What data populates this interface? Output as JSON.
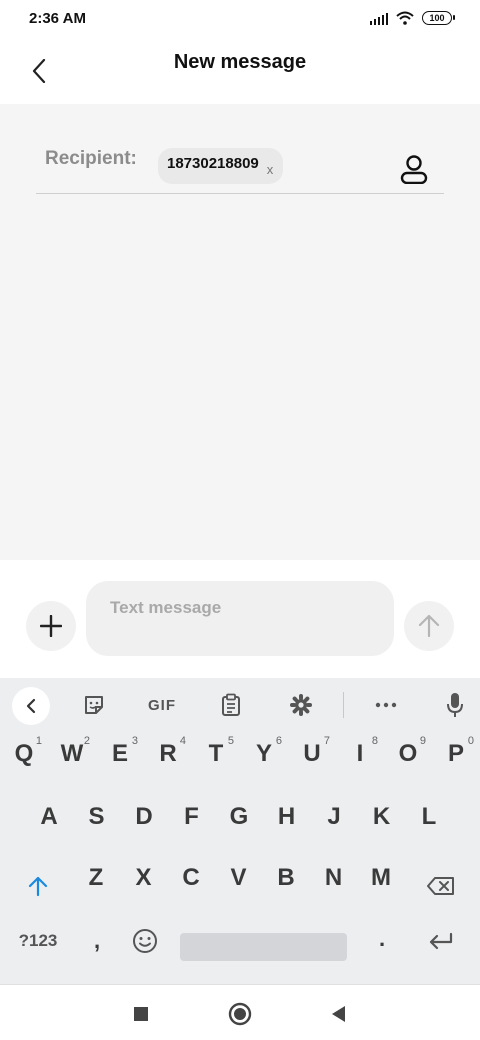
{
  "status_bar": {
    "time": "2:36 AM",
    "battery": "100"
  },
  "header": {
    "title": "New message"
  },
  "recipient": {
    "label": "Recipient:",
    "chip_value": "18730218809",
    "chip_remove": "x"
  },
  "compose": {
    "placeholder": "Text message"
  },
  "keyboard": {
    "toolbar": {
      "gif": "GIF"
    },
    "row1": [
      {
        "key": "Q",
        "alt": "1"
      },
      {
        "key": "W",
        "alt": "2"
      },
      {
        "key": "E",
        "alt": "3"
      },
      {
        "key": "R",
        "alt": "4"
      },
      {
        "key": "T",
        "alt": "5"
      },
      {
        "key": "Y",
        "alt": "6"
      },
      {
        "key": "U",
        "alt": "7"
      },
      {
        "key": "I",
        "alt": "8"
      },
      {
        "key": "O",
        "alt": "9"
      },
      {
        "key": "P",
        "alt": "0"
      }
    ],
    "row2": [
      "A",
      "S",
      "D",
      "F",
      "G",
      "H",
      "J",
      "K",
      "L"
    ],
    "row3": [
      "Z",
      "X",
      "C",
      "V",
      "B",
      "N",
      "M"
    ],
    "row4": {
      "symbols": "?123",
      "comma": ",",
      "period": "."
    }
  },
  "colors": {
    "accent_blue": "#1a8ae0",
    "screen_bg": "#f5f5f5",
    "keyboard_bg": "#eceef0"
  }
}
